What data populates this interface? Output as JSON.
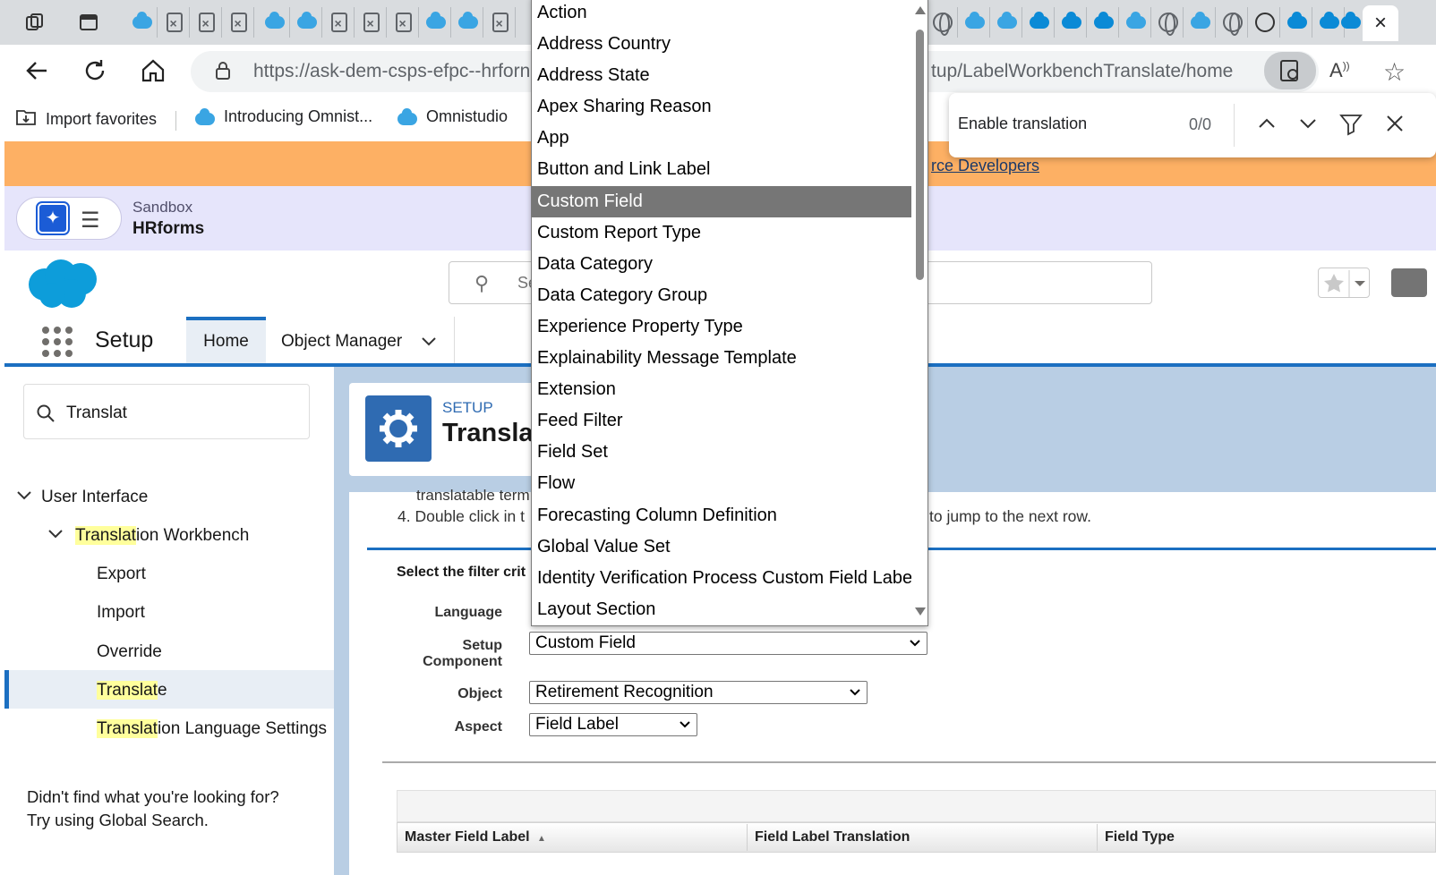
{
  "browser": {
    "url_visible_left": "https://ask-dem-csps-efpc--hrforn",
    "url_visible_right": "tup/LabelWorkbenchTranslate/home",
    "active_tab_close": "×",
    "favorites": [
      "Import favorites",
      "Introducing Omnist...",
      "Omnistudio"
    ],
    "find": {
      "query": "Enable translation",
      "count": "0/0"
    }
  },
  "banner": {
    "link_text": "rce Developers"
  },
  "sandbox": {
    "label": "Sandbox",
    "name": "HRforms"
  },
  "sf_header": {
    "search_placeholder": "Se"
  },
  "setup_nav": {
    "title": "Setup",
    "tabs": [
      "Home",
      "Object Manager"
    ]
  },
  "sidebar": {
    "quick_find": "Translat",
    "tree": {
      "user_interface": "User Interface",
      "workbench_hl": "Translat",
      "workbench_rest": "ion Workbench",
      "export": "Export",
      "import": "Import",
      "override": "Override",
      "translate_hl": "Translat",
      "translate_rest": "e",
      "lang_settings_hl": "Translat",
      "lang_settings_rest": "ion Language Settings"
    },
    "not_found_line1": "Didn't find what you're looking for?",
    "not_found_line2": "Try using Global Search."
  },
  "page_header": {
    "eyebrow": "SETUP",
    "title": "Transla"
  },
  "instructions": {
    "line3_partial": "translatable term",
    "line4_start": "4. Double click in t",
    "line4_end": "to jump to the next row."
  },
  "filter": {
    "title": "Select the filter crit",
    "language_label": "Language",
    "component_label_1": "Setup",
    "component_label_2": "Component",
    "component_value": "Custom Field",
    "object_label": "Object",
    "object_value": "Retirement Recognition",
    "aspect_label": "Aspect",
    "aspect_value": "Field Label"
  },
  "table": {
    "columns": [
      "Master Field Label",
      "Field Label Translation",
      "Field Type"
    ]
  },
  "dropdown": {
    "selected": "Custom Field",
    "options": [
      "Action",
      "Address Country",
      "Address State",
      "Apex Sharing Reason",
      "App",
      "Button and Link Label",
      "Custom Field",
      "Custom Report Type",
      "Data Category",
      "Data Category Group",
      "Experience Property Type",
      "Explainability Message Template",
      "Extension",
      "Feed Filter",
      "Field Set",
      "Flow",
      "Forecasting Column Definition",
      "Global Value Set",
      "Identity Verification Process Custom Field Label",
      "Layout Section"
    ]
  }
}
